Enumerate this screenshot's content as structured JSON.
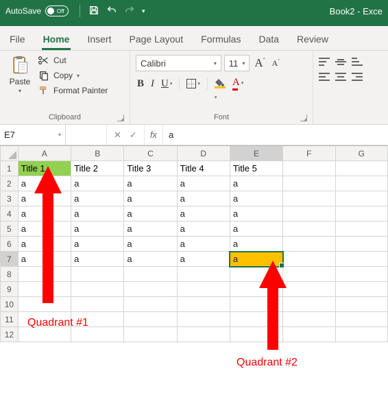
{
  "titlebar": {
    "autosave_label": "AutoSave",
    "autosave_state": "Off",
    "doc_title": "Book2 - Exce"
  },
  "tabs": {
    "file": "File",
    "home": "Home",
    "insert": "Insert",
    "page_layout": "Page Layout",
    "formulas": "Formulas",
    "data": "Data",
    "review": "Review"
  },
  "ribbon": {
    "clipboard": {
      "paste": "Paste",
      "cut": "Cut",
      "copy": "Copy",
      "format_painter": "Format Painter",
      "group_label": "Clipboard"
    },
    "font": {
      "name": "Calibri",
      "size": "11",
      "bold": "B",
      "italic": "I",
      "underline": "U",
      "fontcolor_glyph": "A",
      "group_label": "Font"
    }
  },
  "fxrow": {
    "namebox": "E7",
    "cancel": "✕",
    "confirm": "✓",
    "fx": "fx",
    "formula": "a"
  },
  "grid": {
    "col_headers": [
      "A",
      "B",
      "C",
      "D",
      "E",
      "F",
      "G"
    ],
    "row_headers": [
      "1",
      "2",
      "3",
      "4",
      "5",
      "6",
      "7",
      "8",
      "9",
      "10",
      "11",
      "12"
    ],
    "header_row": [
      "Title 1",
      "Title 2",
      "Title 3",
      "Title 4",
      "Title 5",
      "",
      ""
    ],
    "data_rows": [
      [
        "a",
        "a",
        "a",
        "a",
        "a",
        "",
        ""
      ],
      [
        "a",
        "a",
        "a",
        "a",
        "a",
        "",
        ""
      ],
      [
        "a",
        "a",
        "a",
        "a",
        "a",
        "",
        ""
      ],
      [
        "a",
        "a",
        "a",
        "a",
        "a",
        "",
        ""
      ],
      [
        "a",
        "a",
        "a",
        "a",
        "a",
        "",
        ""
      ],
      [
        "a",
        "a",
        "a",
        "a",
        "a",
        "",
        ""
      ]
    ],
    "highlight_a1_color": "#92d050",
    "selected_cell": "E7",
    "selected_fill": "#ffc000"
  },
  "annotations": {
    "q1": "Quadrant #1",
    "q2": "Quadrant #2"
  }
}
